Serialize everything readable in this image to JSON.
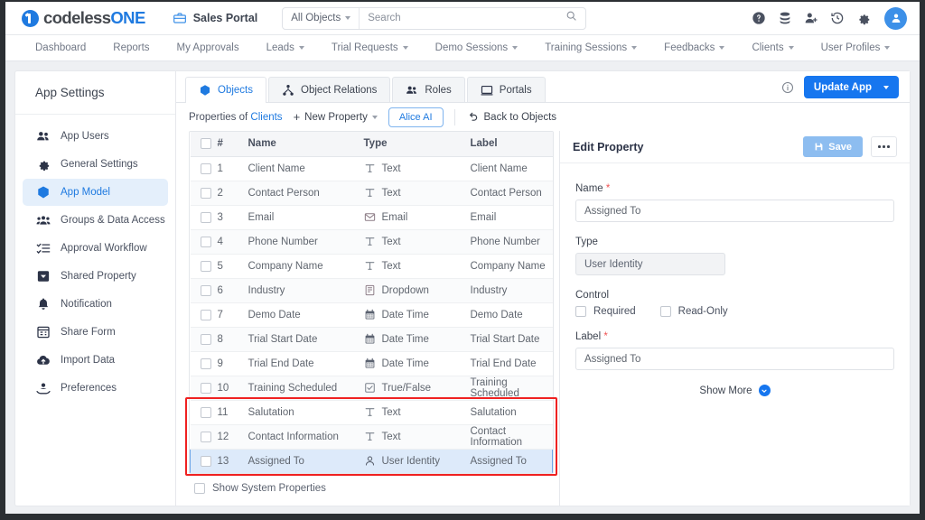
{
  "topbar": {
    "logo_a": "codeless",
    "logo_b": "ONE",
    "portal_name": "Sales Portal",
    "scope_selector": "All Objects",
    "search_placeholder": "Search",
    "search_value": "",
    "icons": [
      "help-icon",
      "database-icon",
      "add-user-icon",
      "history-icon",
      "gear-icon",
      "avatar-icon"
    ]
  },
  "nav": {
    "items": [
      {
        "label": "Dashboard",
        "caret": false
      },
      {
        "label": "Reports",
        "caret": false
      },
      {
        "label": "My Approvals",
        "caret": false
      },
      {
        "label": "Leads",
        "caret": true
      },
      {
        "label": "Trial Requests",
        "caret": true
      },
      {
        "label": "Demo Sessions",
        "caret": true
      },
      {
        "label": "Training Sessions",
        "caret": true
      },
      {
        "label": "Feedbacks",
        "caret": true
      },
      {
        "label": "Clients",
        "caret": true
      },
      {
        "label": "User Profiles",
        "caret": true
      }
    ]
  },
  "sidebar": {
    "title": "App Settings",
    "items": [
      {
        "label": "App Users",
        "icon": "users-icon",
        "active": false
      },
      {
        "label": "General Settings",
        "icon": "gear-icon",
        "active": false
      },
      {
        "label": "App Model",
        "icon": "cube-icon",
        "active": true
      },
      {
        "label": "Groups & Data Access",
        "icon": "group-icon",
        "active": false
      },
      {
        "label": "Approval Workflow",
        "icon": "checklist-icon",
        "active": false
      },
      {
        "label": "Shared Property",
        "icon": "tag-icon",
        "active": false
      },
      {
        "label": "Notification",
        "icon": "bell-icon",
        "active": false
      },
      {
        "label": "Share Form",
        "icon": "form-icon",
        "active": false
      },
      {
        "label": "Import Data",
        "icon": "cloud-upload-icon",
        "active": false
      },
      {
        "label": "Preferences",
        "icon": "preferences-icon",
        "active": false
      }
    ]
  },
  "tabs": [
    {
      "label": "Objects",
      "icon": "cube-icon",
      "active": true
    },
    {
      "label": "Object Relations",
      "icon": "relations-icon",
      "active": false
    },
    {
      "label": "Roles",
      "icon": "users-icon",
      "active": false
    },
    {
      "label": "Portals",
      "icon": "monitor-icon",
      "active": false
    }
  ],
  "tab_actions": {
    "info_icon": "info-icon",
    "update_label": "Update App"
  },
  "toolbar": {
    "properties_of": "Properties of",
    "object_name": "Clients",
    "new_property": "New Property",
    "alice_ai": "Alice AI",
    "back_to_objects": "Back to Objects"
  },
  "table": {
    "headers": [
      "#",
      "Name",
      "Type",
      "Label"
    ],
    "rows": [
      {
        "num": "1",
        "name": "Client Name",
        "type": "Text",
        "type_icon": "text-icon",
        "label": "Client Name",
        "selected": false,
        "highlight": false
      },
      {
        "num": "2",
        "name": "Contact Person",
        "type": "Text",
        "type_icon": "text-icon",
        "label": "Contact Person",
        "selected": false,
        "highlight": false
      },
      {
        "num": "3",
        "name": "Email",
        "type": "Email",
        "type_icon": "email-icon",
        "label": "Email",
        "selected": false,
        "highlight": false
      },
      {
        "num": "4",
        "name": "Phone Number",
        "type": "Text",
        "type_icon": "text-icon",
        "label": "Phone Number",
        "selected": false,
        "highlight": false
      },
      {
        "num": "5",
        "name": "Company Name",
        "type": "Text",
        "type_icon": "text-icon",
        "label": "Company Name",
        "selected": false,
        "highlight": false
      },
      {
        "num": "6",
        "name": "Industry",
        "type": "Dropdown",
        "type_icon": "dropdown-icon",
        "label": "Industry",
        "selected": false,
        "highlight": false
      },
      {
        "num": "7",
        "name": "Demo Date",
        "type": "Date Time",
        "type_icon": "calendar-icon",
        "label": "Demo Date",
        "selected": false,
        "highlight": false
      },
      {
        "num": "8",
        "name": "Trial Start Date",
        "type": "Date Time",
        "type_icon": "calendar-icon",
        "label": "Trial Start Date",
        "selected": false,
        "highlight": false
      },
      {
        "num": "9",
        "name": "Trial End Date",
        "type": "Date Time",
        "type_icon": "calendar-icon",
        "label": "Trial End Date",
        "selected": false,
        "highlight": false
      },
      {
        "num": "10",
        "name": "Training Scheduled",
        "type": "True/False",
        "type_icon": "checkbox-icon",
        "label": "Training Scheduled",
        "selected": false,
        "highlight": false
      },
      {
        "num": "11",
        "name": "Salutation",
        "type": "Text",
        "type_icon": "text-icon",
        "label": "Salutation",
        "selected": false,
        "highlight": true
      },
      {
        "num": "12",
        "name": "Contact Information",
        "type": "Text",
        "type_icon": "text-icon",
        "label": "Contact Information",
        "selected": false,
        "highlight": true
      },
      {
        "num": "13",
        "name": "Assigned To",
        "type": "User Identity",
        "type_icon": "person-icon",
        "label": "Assigned To",
        "selected": true,
        "highlight": true
      }
    ],
    "show_system_properties": "Show System Properties"
  },
  "edit_panel": {
    "title": "Edit Property",
    "save_label": "Save",
    "name_label": "Name",
    "name_value": "Assigned To",
    "type_label": "Type",
    "type_value": "User Identity",
    "control_label": "Control",
    "required_label": "Required",
    "readonly_label": "Read-Only",
    "field_label_label": "Label",
    "field_label_value": "Assigned To",
    "show_more": "Show More"
  },
  "colors": {
    "accent": "#1676ef",
    "logo_blue": "#1f7ae0",
    "highlight_border": "#ef2121",
    "selected_row": "#ddeafa",
    "required": "#f05454"
  }
}
